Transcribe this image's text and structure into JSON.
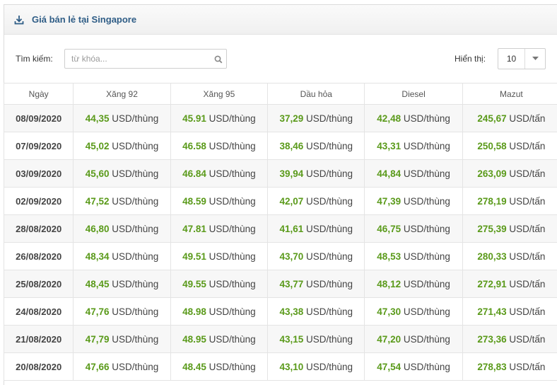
{
  "header": {
    "title": "Giá bán lẻ tại Singapore",
    "icon": "download-icon"
  },
  "search": {
    "label": "Tìm kiếm:",
    "placeholder": "từ khóa...",
    "value": ""
  },
  "page_size": {
    "label": "Hiển thị:",
    "value": "10"
  },
  "colors": {
    "accent_title": "#2f5d86",
    "value_green": "#5a9a1a"
  },
  "table": {
    "columns": [
      "Ngày",
      "Xăng 92",
      "Xăng 95",
      "Dầu hỏa",
      "Diesel",
      "Mazut"
    ],
    "rows": [
      {
        "date": "08/09/2020",
        "cells": [
          {
            "v": "44,35",
            "u": " USD/thùng"
          },
          {
            "v": "45.91",
            "u": " USD/thùng"
          },
          {
            "v": "37,29",
            "u": " USD/thùng"
          },
          {
            "v": "42,48",
            "u": " USD/thùng"
          },
          {
            "v": "245,67",
            "u": " USD/tấn"
          }
        ]
      },
      {
        "date": "07/09/2020",
        "cells": [
          {
            "v": "45,02",
            "u": " USD/thùng"
          },
          {
            "v": "46.58",
            "u": " USD/thùng"
          },
          {
            "v": "38,46",
            "u": " USD/thùng"
          },
          {
            "v": "43,31",
            "u": " USD/thùng"
          },
          {
            "v": "250,58",
            "u": " USD/tấn"
          }
        ]
      },
      {
        "date": "03/09/2020",
        "cells": [
          {
            "v": "45,60",
            "u": " USD/thùng"
          },
          {
            "v": "46.84",
            "u": " USD/thùng"
          },
          {
            "v": "39,94",
            "u": " USD/thùng"
          },
          {
            "v": "44,84",
            "u": " USD/thùng"
          },
          {
            "v": "263,09",
            "u": " USD/tấn"
          }
        ]
      },
      {
        "date": "02/09/2020",
        "cells": [
          {
            "v": "47,52",
            "u": " USD/thùng"
          },
          {
            "v": "48.59",
            "u": " USD/thùng"
          },
          {
            "v": "42,07",
            "u": " USD/thùng"
          },
          {
            "v": "47,39",
            "u": " USD/thùng"
          },
          {
            "v": "278,19",
            "u": " USD/tấn"
          }
        ]
      },
      {
        "date": "28/08/2020",
        "cells": [
          {
            "v": "46,80",
            "u": " USD/thùng"
          },
          {
            "v": "47.81",
            "u": " USD/thùng"
          },
          {
            "v": "41,61",
            "u": " USD/thùng"
          },
          {
            "v": "46,75",
            "u": " USD/thùng"
          },
          {
            "v": "275,39",
            "u": " USD/tấn"
          }
        ]
      },
      {
        "date": "26/08/2020",
        "cells": [
          {
            "v": "48,34",
            "u": " USD/thùng"
          },
          {
            "v": "49.51",
            "u": " USD/thùng"
          },
          {
            "v": "43,70",
            "u": " USD/thùng"
          },
          {
            "v": "48,53",
            "u": " USD/thùng"
          },
          {
            "v": "280,33",
            "u": " USD/tấn"
          }
        ]
      },
      {
        "date": "25/08/2020",
        "cells": [
          {
            "v": "48,45",
            "u": " USD/thùng"
          },
          {
            "v": "49.55",
            "u": " USD/thùng"
          },
          {
            "v": "43,77",
            "u": " USD/thùng"
          },
          {
            "v": "48,12",
            "u": " USD/thùng"
          },
          {
            "v": "272,91",
            "u": " USD/tấn"
          }
        ]
      },
      {
        "date": "24/08/2020",
        "cells": [
          {
            "v": "47,76",
            "u": " USD/thùng"
          },
          {
            "v": "48.98",
            "u": " USD/thùng"
          },
          {
            "v": "43,38",
            "u": " USD/thùng"
          },
          {
            "v": "47,30",
            "u": " USD/thùng"
          },
          {
            "v": "271,43",
            "u": " USD/tấn"
          }
        ]
      },
      {
        "date": "21/08/2020",
        "cells": [
          {
            "v": "47,79",
            "u": " USD/thùng"
          },
          {
            "v": "48.95",
            "u": " USD/thùng"
          },
          {
            "v": "43,15",
            "u": " USD/thùng"
          },
          {
            "v": "47,20",
            "u": " USD/thùng"
          },
          {
            "v": "273,36",
            "u": " USD/tấn"
          }
        ]
      },
      {
        "date": "20/08/2020",
        "cells": [
          {
            "v": "47,66",
            "u": " USD/thùng"
          },
          {
            "v": "48.45",
            "u": " USD/thùng"
          },
          {
            "v": "43,10",
            "u": " USD/thùng"
          },
          {
            "v": "47,54",
            "u": " USD/thùng"
          },
          {
            "v": "278,83",
            "u": " USD/tấn"
          }
        ]
      }
    ]
  }
}
